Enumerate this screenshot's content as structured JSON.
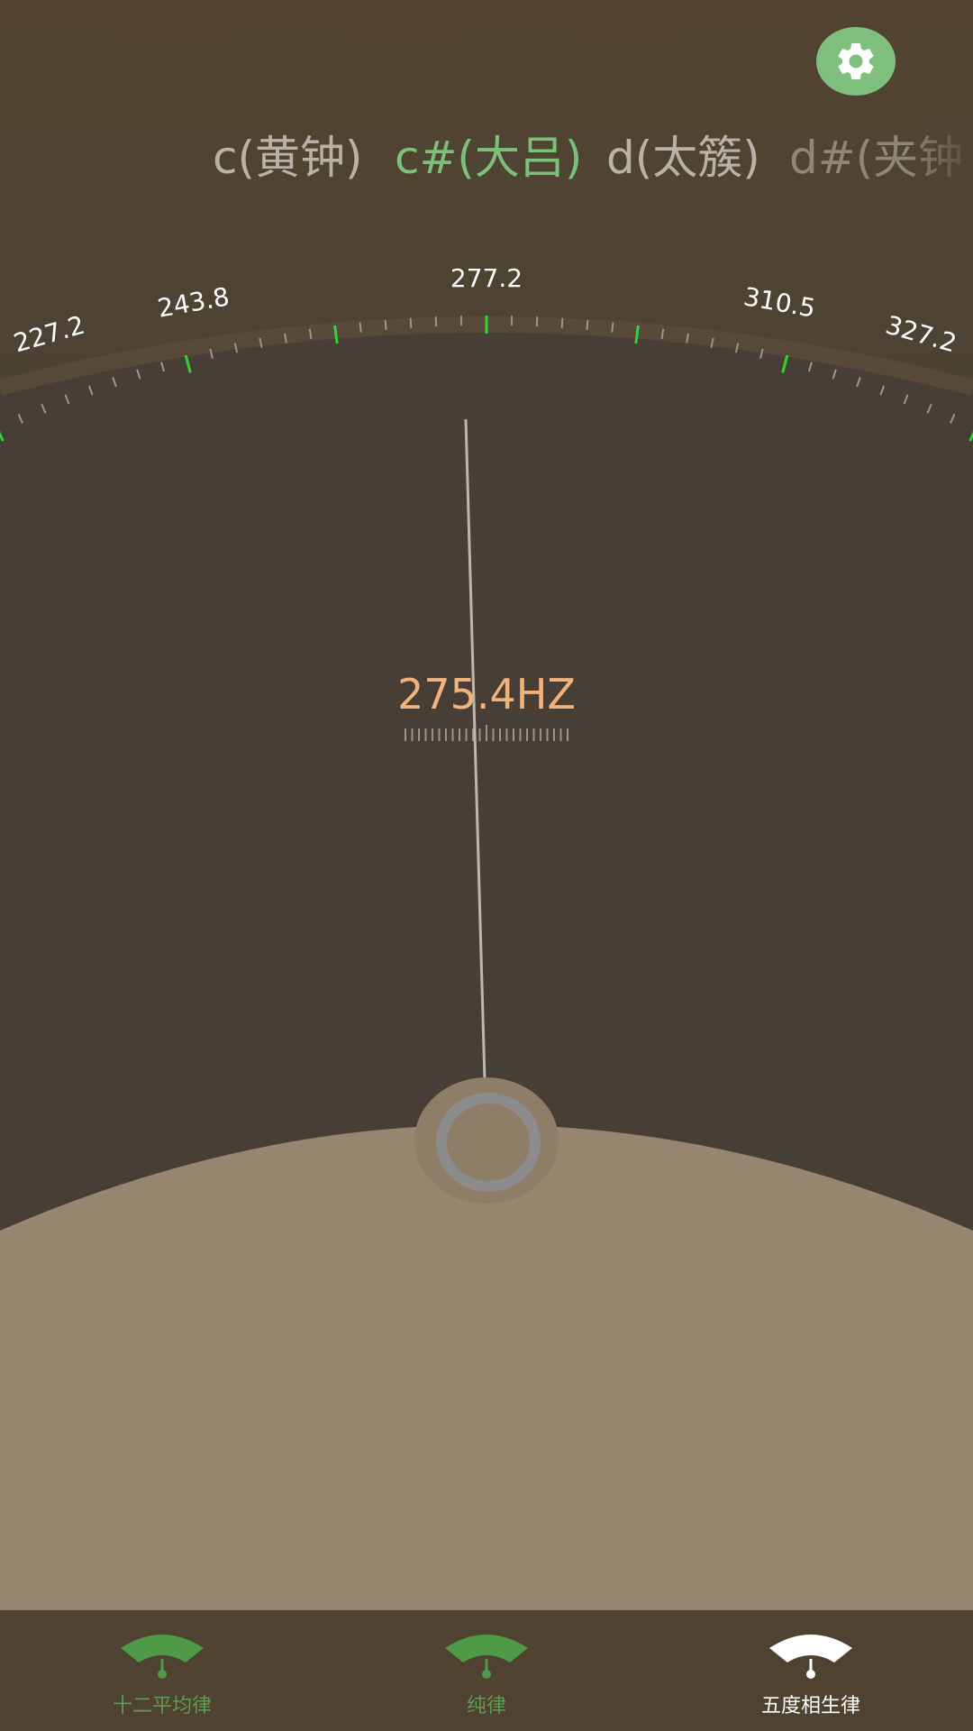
{
  "settings": {
    "icon": "gear-icon",
    "bg_color": "#7fc07e"
  },
  "notes": [
    {
      "label": "c(黄钟)",
      "state": "normal"
    },
    {
      "label": "c#(大吕)",
      "state": "selected"
    },
    {
      "label": "d(太簇)",
      "state": "normal"
    },
    {
      "label": "d#(夹钟",
      "state": "faded"
    }
  ],
  "scale": {
    "labels": [
      "227.2",
      "243.8",
      "277.2",
      "310.5",
      "327.2"
    ],
    "tick_color": "#33d433"
  },
  "readout": {
    "frequency": "275.4HZ",
    "color": "#f2b27c"
  },
  "bottom_nav": {
    "items": [
      {
        "label": "十二平均律",
        "active": false
      },
      {
        "label": "纯律",
        "active": false
      },
      {
        "label": "五度相生律",
        "active": true
      }
    ],
    "active_color": "#ffffff",
    "inactive_color": "#5f9a55"
  }
}
